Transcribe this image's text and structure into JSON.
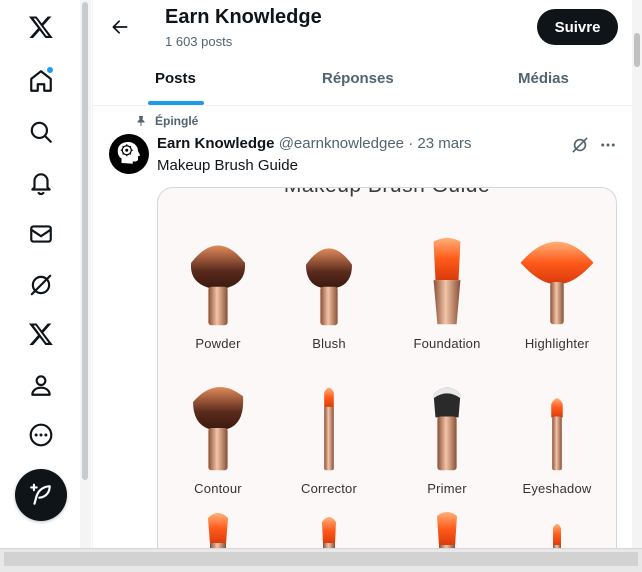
{
  "nav": {
    "items": [
      {
        "id": "x-logo",
        "icon": "x-logo-icon"
      },
      {
        "id": "home",
        "icon": "home-icon",
        "has_badge": true
      },
      {
        "id": "explore",
        "icon": "search-icon"
      },
      {
        "id": "notifications",
        "icon": "bell-icon"
      },
      {
        "id": "messages",
        "icon": "mail-icon"
      },
      {
        "id": "grok",
        "icon": "grok-icon"
      },
      {
        "id": "premium",
        "icon": "x-logo-icon"
      },
      {
        "id": "profile",
        "icon": "user-icon"
      },
      {
        "id": "more",
        "icon": "more-circle-icon"
      }
    ],
    "post_button_icon": "compose-feather-icon"
  },
  "header": {
    "title": "Earn Knowledge",
    "post_count": "1 603 posts",
    "follow_label": "Suivre"
  },
  "tabs": [
    {
      "label": "Posts",
      "active": true
    },
    {
      "label": "Réponses",
      "active": false
    },
    {
      "label": "Médias",
      "active": false
    }
  ],
  "post": {
    "pinned_label": "Épinglé",
    "author_name": "Earn Knowledge",
    "author_handle": "@earnknowledgee",
    "separator": "·",
    "date": "23 mars",
    "text": "Makeup Brush Guide",
    "media": {
      "title": "Makeup Brush Guide",
      "brushes": [
        {
          "label": "Powder"
        },
        {
          "label": "Blush"
        },
        {
          "label": "Foundation"
        },
        {
          "label": "Highlighter"
        },
        {
          "label": "Contour"
        },
        {
          "label": "Corrector"
        },
        {
          "label": "Primer"
        },
        {
          "label": "Eyeshadow"
        }
      ]
    }
  },
  "colors": {
    "accent": "#1d9bf0",
    "text_primary": "#0f1419",
    "text_secondary": "#536471",
    "bristle_dark": "#5a2a1c",
    "bristle_orange": "#ff5a1a",
    "ferrule_copper": "#c98865"
  }
}
